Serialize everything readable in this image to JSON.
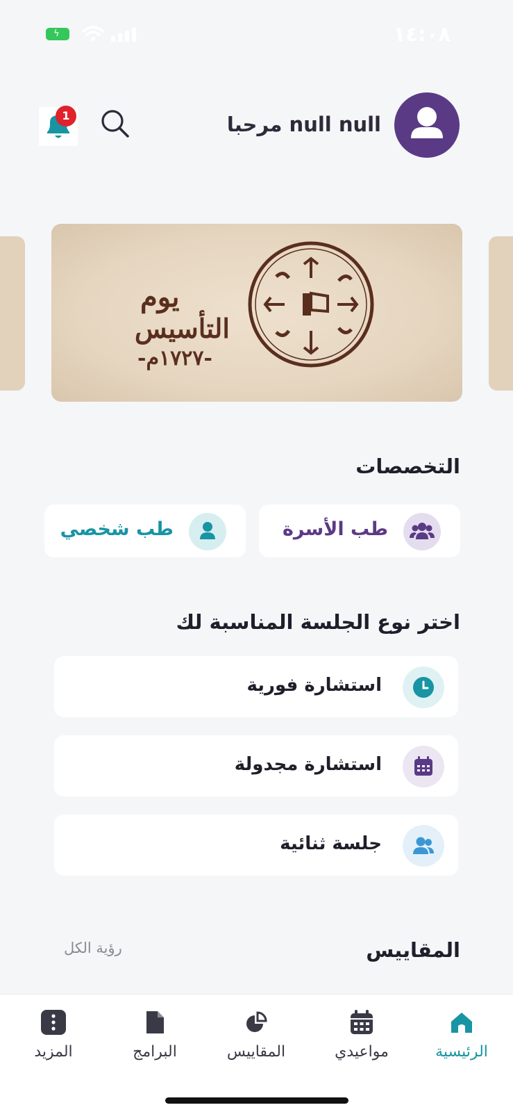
{
  "status_bar": {
    "time": "١٤:٠٨"
  },
  "header": {
    "greeting": "null null مرحبا",
    "notification_count": "1",
    "icons": [
      "user-icon",
      "search-icon",
      "bell-icon"
    ]
  },
  "banner": {
    "title_line1": "يوم",
    "title_line2": "التأسيس",
    "year": "-١٧٢٧م-"
  },
  "specialties": {
    "title": "التخصصات",
    "items": [
      {
        "label": "طب الأسرة",
        "icon": "family-icon",
        "color": "#5b3a85",
        "bg": "#e4ddef"
      },
      {
        "label": "طب شخصي",
        "icon": "person-icon",
        "color": "#1894a3",
        "bg": "#d7eef1"
      }
    ]
  },
  "sessions": {
    "title": "اختر نوع الجلسة المناسبة لك",
    "items": [
      {
        "label": "استشارة فورية",
        "icon": "clock-icon",
        "color": "#1894a3",
        "bg": "#dff1f3"
      },
      {
        "label": "استشارة مجدولة",
        "icon": "calendar-icon",
        "color": "#5b3a85",
        "bg": "#ebe6f2"
      },
      {
        "label": "جلسة ثنائية",
        "icon": "users-icon",
        "color": "#3a97d4",
        "bg": "#e3f0f9"
      }
    ]
  },
  "measures": {
    "title": "المقاييس",
    "see_all": "رؤية الكل"
  },
  "tab_bar": {
    "items": [
      {
        "label": "الرئيسية",
        "icon": "home-icon",
        "active": true
      },
      {
        "label": "مواعيدي",
        "icon": "calendar-icon",
        "active": false
      },
      {
        "label": "المقاييس",
        "icon": "pie-chart-icon",
        "active": false
      },
      {
        "label": "البرامج",
        "icon": "document-icon",
        "active": false
      },
      {
        "label": "المزيد",
        "icon": "more-icon",
        "active": false
      }
    ]
  },
  "colors": {
    "accent_teal": "#1894a3",
    "accent_purple": "#5b3a85",
    "badge_red": "#e0222d",
    "background": "#f5f6f8"
  }
}
